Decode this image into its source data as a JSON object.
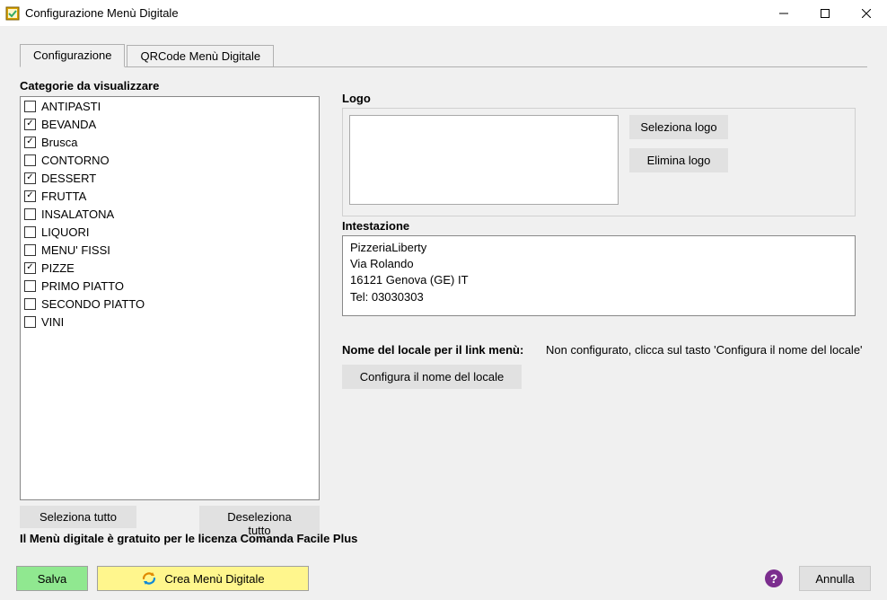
{
  "window": {
    "title": "Configurazione Menù Digitale"
  },
  "tabs": {
    "tab1": "Configurazione",
    "tab2": "QRCode Menù Digitale"
  },
  "categories": {
    "label": "Categorie da visualizzare",
    "items": [
      {
        "label": "ANTIPASTI",
        "checked": false
      },
      {
        "label": "BEVANDA",
        "checked": true
      },
      {
        "label": "Brusca",
        "checked": true
      },
      {
        "label": "CONTORNO",
        "checked": false
      },
      {
        "label": "DESSERT",
        "checked": true
      },
      {
        "label": "FRUTTA",
        "checked": true
      },
      {
        "label": "INSALATONA",
        "checked": false
      },
      {
        "label": "LIQUORI",
        "checked": false
      },
      {
        "label": "MENU' FISSI",
        "checked": false
      },
      {
        "label": "PIZZE",
        "checked": true
      },
      {
        "label": "PRIMO PIATTO",
        "checked": false
      },
      {
        "label": "SECONDO PIATTO",
        "checked": false
      },
      {
        "label": "VINI",
        "checked": false
      }
    ],
    "select_all": "Seleziona tutto",
    "deselect_all": "Deseleziona tutto"
  },
  "logo": {
    "label": "Logo",
    "select": "Seleziona logo",
    "delete": "Elimina logo"
  },
  "intestazione": {
    "label": "Intestazione",
    "value": "PizzeriaLiberty\nVia Rolando\n16121 Genova (GE) IT\nTel: 03030303"
  },
  "link": {
    "label": "Nome del locale per il link menù:",
    "value": "Non configurato, clicca sul tasto 'Configura il nome del locale'",
    "config_btn": "Configura il nome del locale"
  },
  "note": "Il Menù digitale è gratuito per le licenza Comanda Facile Plus",
  "bottom": {
    "save": "Salva",
    "create": "Crea Menù Digitale",
    "cancel": "Annulla"
  }
}
